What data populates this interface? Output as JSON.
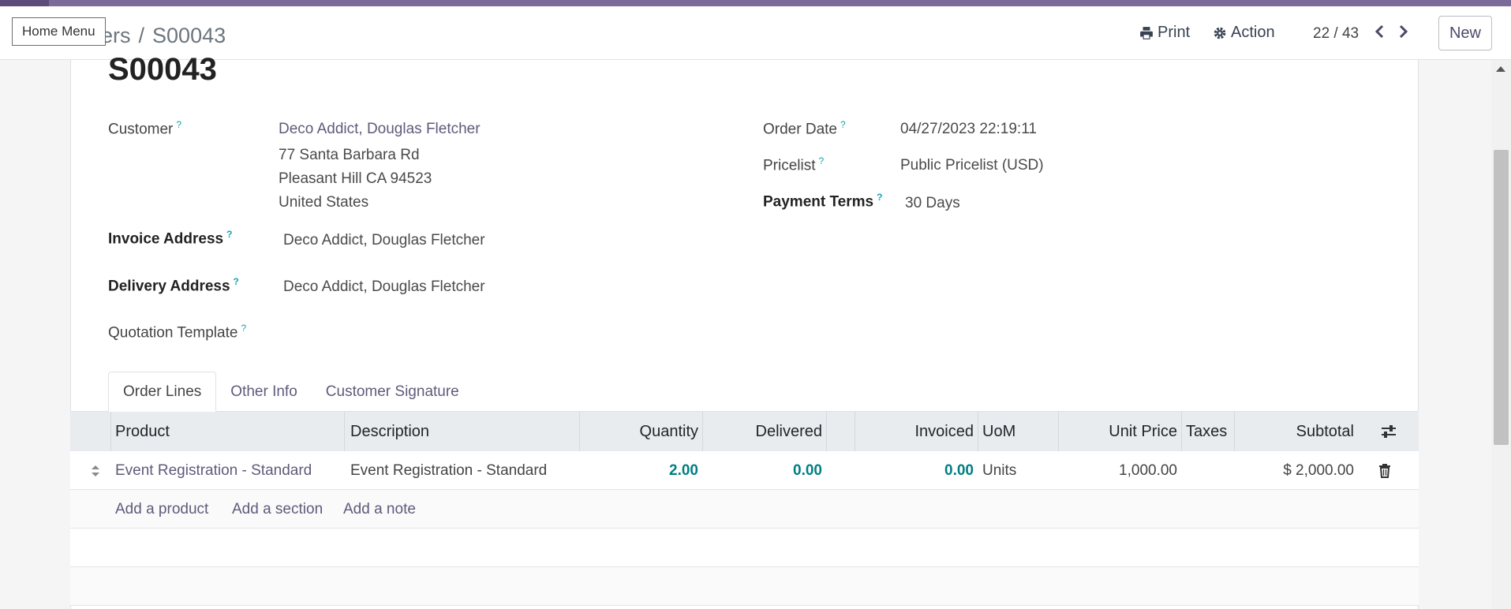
{
  "control_bar": {
    "home_menu_label": "Home Menu",
    "breadcrumb_parent": "ers",
    "breadcrumb_current": "S00043",
    "print_label": "Print",
    "action_label": "Action",
    "pager_value": "22 / 43",
    "new_label": "New"
  },
  "record": {
    "name": "S00043",
    "customer": {
      "label": "Customer",
      "name": "Deco Addict, Douglas Fletcher",
      "address_line1": "77 Santa Barbara Rd",
      "address_line2": "Pleasant Hill CA 94523",
      "address_line3": "United States"
    },
    "invoice_address": {
      "label": "Invoice Address",
      "value": "Deco Addict, Douglas Fletcher"
    },
    "delivery_address": {
      "label": "Delivery Address",
      "value": "Deco Addict, Douglas Fletcher"
    },
    "quotation_template": {
      "label": "Quotation Template",
      "value": ""
    },
    "order_date": {
      "label": "Order Date",
      "value": "04/27/2023 22:19:11"
    },
    "pricelist": {
      "label": "Pricelist",
      "value": "Public Pricelist (USD)"
    },
    "payment_terms": {
      "label": "Payment Terms",
      "value": "30 Days"
    },
    "help_mark": "?"
  },
  "tabs": [
    "Order Lines",
    "Other Info",
    "Customer Signature"
  ],
  "order_lines": {
    "columns": {
      "product": "Product",
      "description": "Description",
      "quantity": "Quantity",
      "delivered": "Delivered",
      "invoiced": "Invoiced",
      "uom": "UoM",
      "unit_price": "Unit Price",
      "taxes": "Taxes",
      "subtotal": "Subtotal"
    },
    "rows": [
      {
        "product": "Event Registration - Standard",
        "description": "Event Registration - Standard",
        "quantity": "2.00",
        "delivered": "0.00",
        "invoiced": "0.00",
        "uom": "Units",
        "unit_price": "1,000.00",
        "taxes": "",
        "subtotal": "$ 2,000.00"
      }
    ],
    "add_product": "Add a product",
    "add_section": "Add a section",
    "add_note": "Add a note"
  },
  "colors": {
    "brand": "#7c6a9a",
    "link": "#5e5b7a",
    "numeric_accent": "#017e84",
    "help_accent": "#17a2b8"
  }
}
